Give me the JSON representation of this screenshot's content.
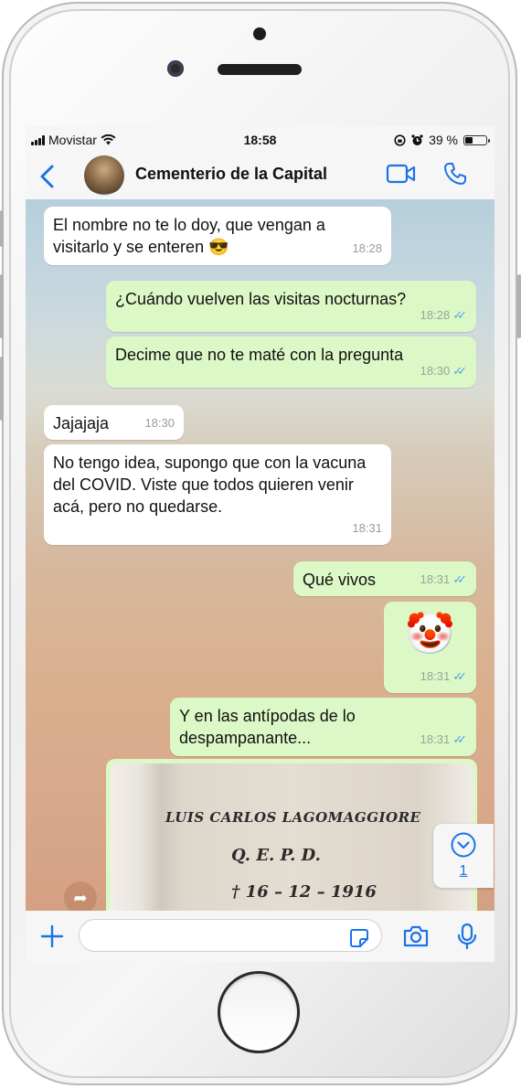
{
  "status_bar": {
    "carrier": "Movistar",
    "time": "18:58",
    "battery_text": "39 %",
    "battery_level": 0.39
  },
  "header": {
    "title": "Cementerio de la Capital"
  },
  "messages": [
    {
      "direction": "in",
      "text": "El nombre no te lo doy, que vengan a visitarlo y se enteren 😎",
      "time": "18:28"
    },
    {
      "direction": "out",
      "text": "¿Cuándo vuelven las visitas nocturnas?",
      "time": "18:28"
    },
    {
      "direction": "out",
      "text": "Decime que no te maté con la pregunta",
      "time": "18:30"
    },
    {
      "direction": "in",
      "text": "Jajajaja",
      "time": "18:30"
    },
    {
      "direction": "in",
      "text": "No tengo idea, supongo que con la vacuna del COVID. Viste que todos quieren venir acá, pero no quedarse.",
      "time": "18:31"
    },
    {
      "direction": "out",
      "text": "Qué vivos",
      "time": "18:31"
    },
    {
      "direction": "out",
      "text": "🤡",
      "time": "18:31"
    },
    {
      "direction": "out",
      "text": "Y en las antípodas de lo despampanante...",
      "time": "18:31"
    }
  ],
  "photo": {
    "line1": "LUIS CARLOS LAGOMAGGIORE",
    "line2": "Q. E. P. D.",
    "line3": "† 16 – 12 – 1916"
  },
  "scroll_down": {
    "unread_count": "1"
  },
  "colors": {
    "accent": "#1a73e8",
    "outgoing_bubble": "#dcf8c6",
    "incoming_bubble": "#ffffff",
    "read_ticks": "#4fa5e6"
  },
  "icons": [
    "back-icon",
    "video-call-icon",
    "phone-call-icon",
    "plus-icon",
    "sticker-icon",
    "camera-icon",
    "microphone-icon",
    "forward-icon",
    "chevron-down-icon"
  ]
}
